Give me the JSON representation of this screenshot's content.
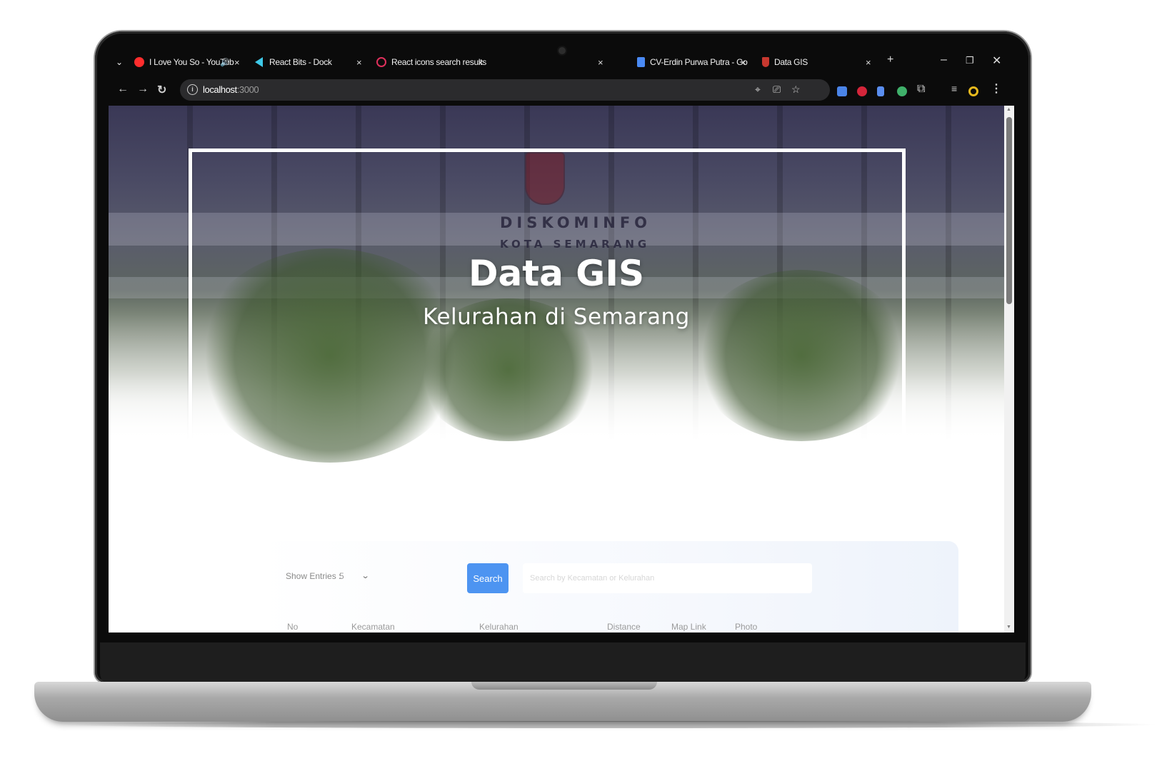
{
  "browser": {
    "tabs": [
      {
        "label": "I Love You So - YouTub",
        "icon": "youtube-icon",
        "audio": "speaker-icon"
      },
      {
        "label": "React Bits - Dock",
        "icon": "react-bits-icon"
      },
      {
        "label": "React icons search results",
        "icon": "react-icons-icon"
      },
      {
        "label": "",
        "icon": ""
      },
      {
        "label": "CV-Erdin Purwa Putra - Go",
        "icon": "google-docs-icon"
      },
      {
        "label": "Data GIS",
        "icon": "shield-favicon-icon"
      }
    ],
    "new_tab": "+",
    "close_glyph": "×",
    "url_host": "localhost",
    "url_port": ":3000"
  },
  "hero": {
    "sign_line1": "DISKOMINFO",
    "sign_line2": "KOTA SEMARANG",
    "title": "Data GIS",
    "subtitle": "Kelurahan di Semarang"
  },
  "controls": {
    "show_entries_label": "Show Entries :",
    "show_entries_value": "5",
    "search_button": "Search",
    "search_placeholder": "Search by Kecamatan or Kelurahan"
  },
  "table": {
    "headers": [
      "No",
      "Kecamatan",
      "Kelurahan",
      "Distance",
      "Map Link",
      "Photo"
    ]
  },
  "colors": {
    "accent": "#4d94f1",
    "chrome_bg": "#0b0b0b"
  }
}
